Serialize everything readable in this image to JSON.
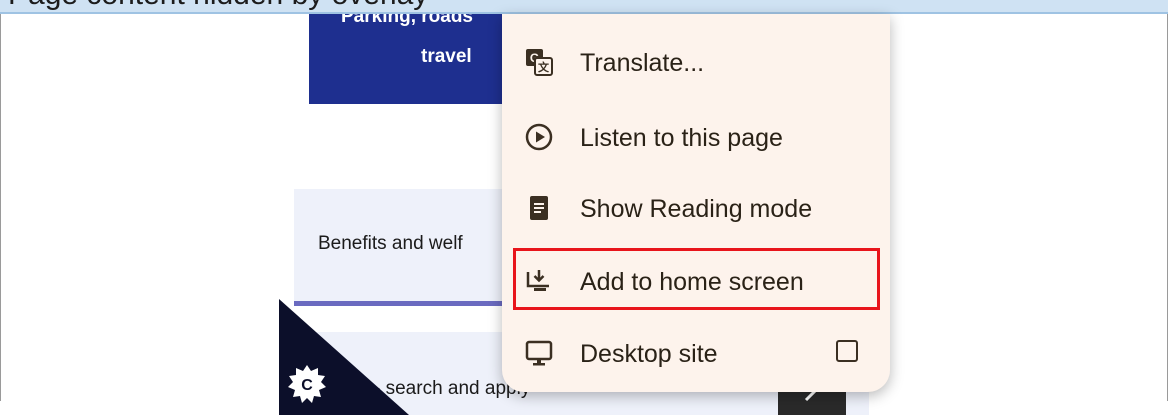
{
  "banner": {
    "text": "Page content hidden by overlay"
  },
  "page": {
    "tile": {
      "line1": "Parking, roads",
      "line2": "travel"
    },
    "benefits_card": {
      "label": "Benefits and welf"
    },
    "search_card": {
      "label": "- search and apply"
    }
  },
  "menu": {
    "items": [
      {
        "label": "Translate...",
        "icon": "translate-icon"
      },
      {
        "label": "Listen to this page",
        "icon": "play-circle-icon"
      },
      {
        "label": "Show Reading mode",
        "icon": "reading-mode-icon"
      },
      {
        "label": "Add to home screen",
        "icon": "add-to-home-screen-icon",
        "highlighted": true
      },
      {
        "label": "Desktop site",
        "icon": "desktop-icon",
        "checkbox": false
      }
    ]
  },
  "colors": {
    "menu_bg": "#fdf3ec",
    "icon_brown": "#3b2f22",
    "highlight_red": "#e8141b",
    "tile_blue": "#1e2f8f"
  }
}
